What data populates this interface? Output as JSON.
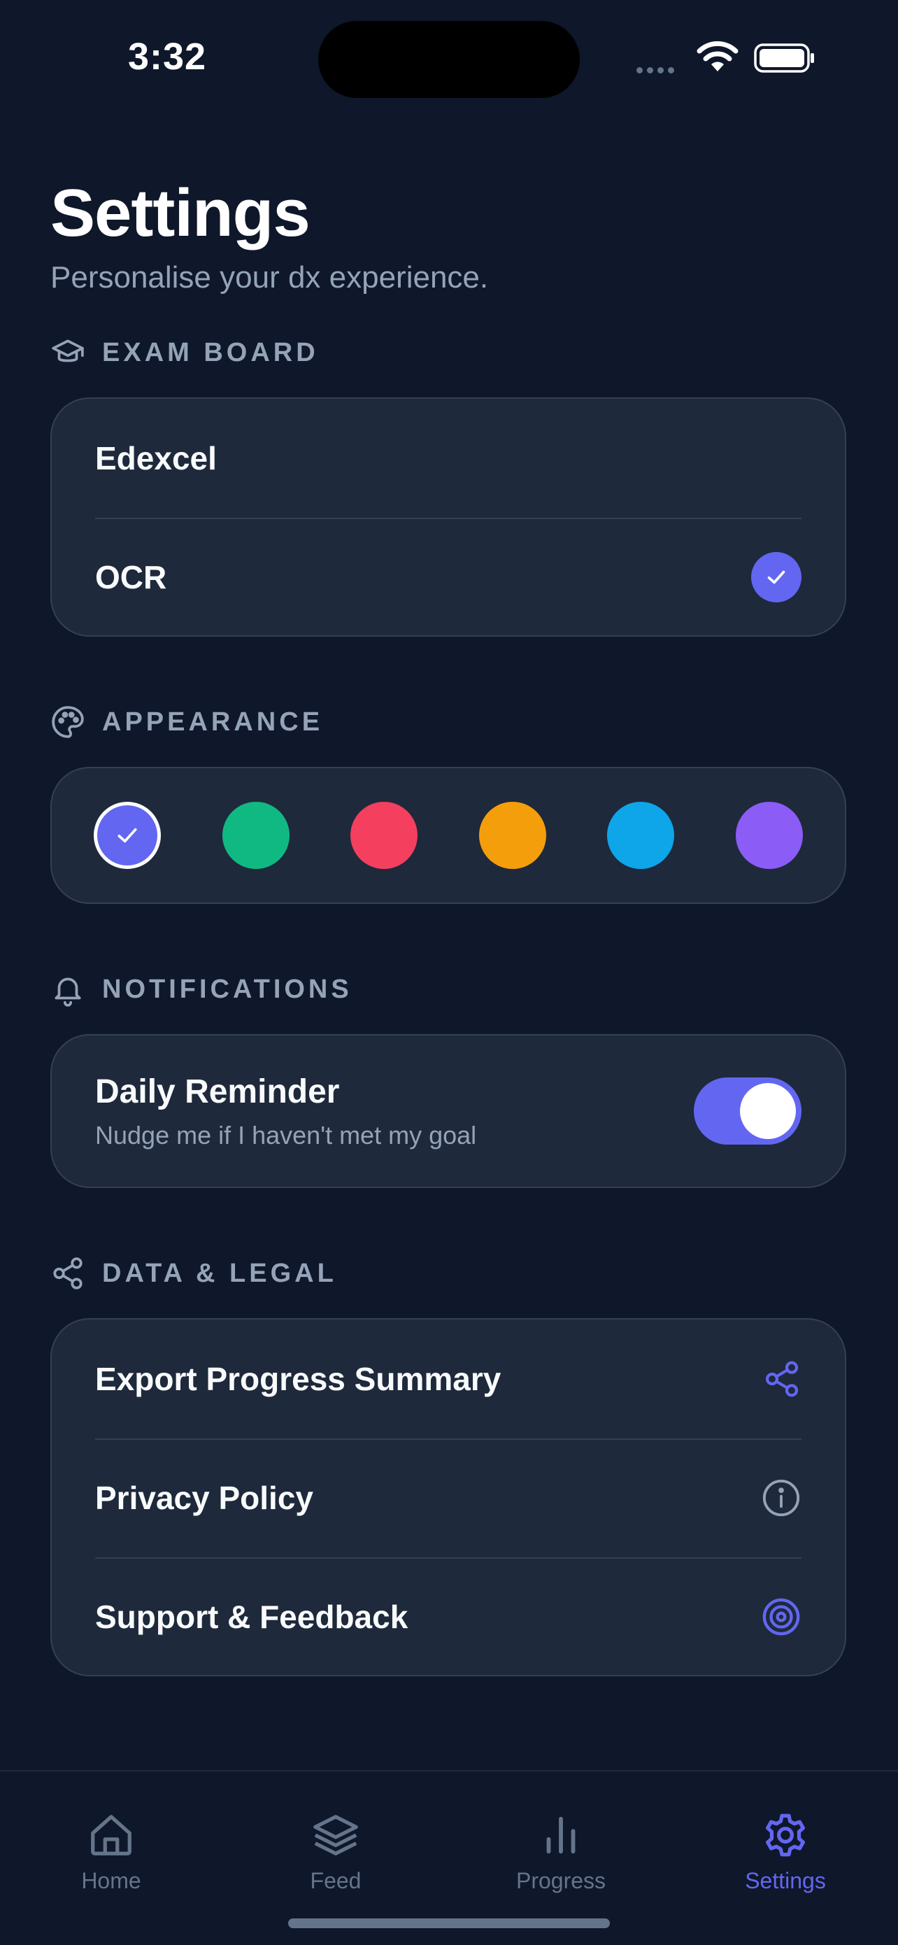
{
  "status_bar": {
    "time": "3:32"
  },
  "header": {
    "title": "Settings",
    "subtitle": "Personalise your dx experience."
  },
  "exam_board": {
    "label": "EXAM BOARD",
    "icon": "graduation-cap-icon",
    "options": [
      {
        "label": "Edexcel",
        "selected": false
      },
      {
        "label": "OCR",
        "selected": true
      }
    ]
  },
  "appearance": {
    "label": "APPEARANCE",
    "icon": "palette-icon",
    "colors": [
      "#6366f1",
      "#10b981",
      "#f43f5e",
      "#f59e0b",
      "#0ea5e9",
      "#8b5cf6"
    ],
    "selected_color": "#6366f1"
  },
  "notifications": {
    "label": "NOTIFICATIONS",
    "icon": "bell-icon",
    "daily_reminder": {
      "title": "Daily Reminder",
      "subtitle": "Nudge me if I haven't met my goal",
      "enabled": true
    }
  },
  "data_legal": {
    "label": "DATA & LEGAL",
    "icon": "share-icon",
    "items": [
      {
        "label": "Export Progress Summary",
        "icon": "share-icon"
      },
      {
        "label": "Privacy Policy",
        "icon": "info-icon"
      },
      {
        "label": "Support & Feedback",
        "icon": "target-icon"
      }
    ]
  },
  "tab_bar": {
    "tabs": [
      {
        "label": "Home",
        "icon": "home-icon",
        "active": false
      },
      {
        "label": "Feed",
        "icon": "layers-icon",
        "active": false
      },
      {
        "label": "Progress",
        "icon": "bar-chart-icon",
        "active": false
      },
      {
        "label": "Settings",
        "icon": "gear-icon",
        "active": true
      }
    ]
  },
  "colors": {
    "background": "#0f172a",
    "card": "#1e293b",
    "accent": "#6366f1",
    "muted": "#94a3b8"
  }
}
